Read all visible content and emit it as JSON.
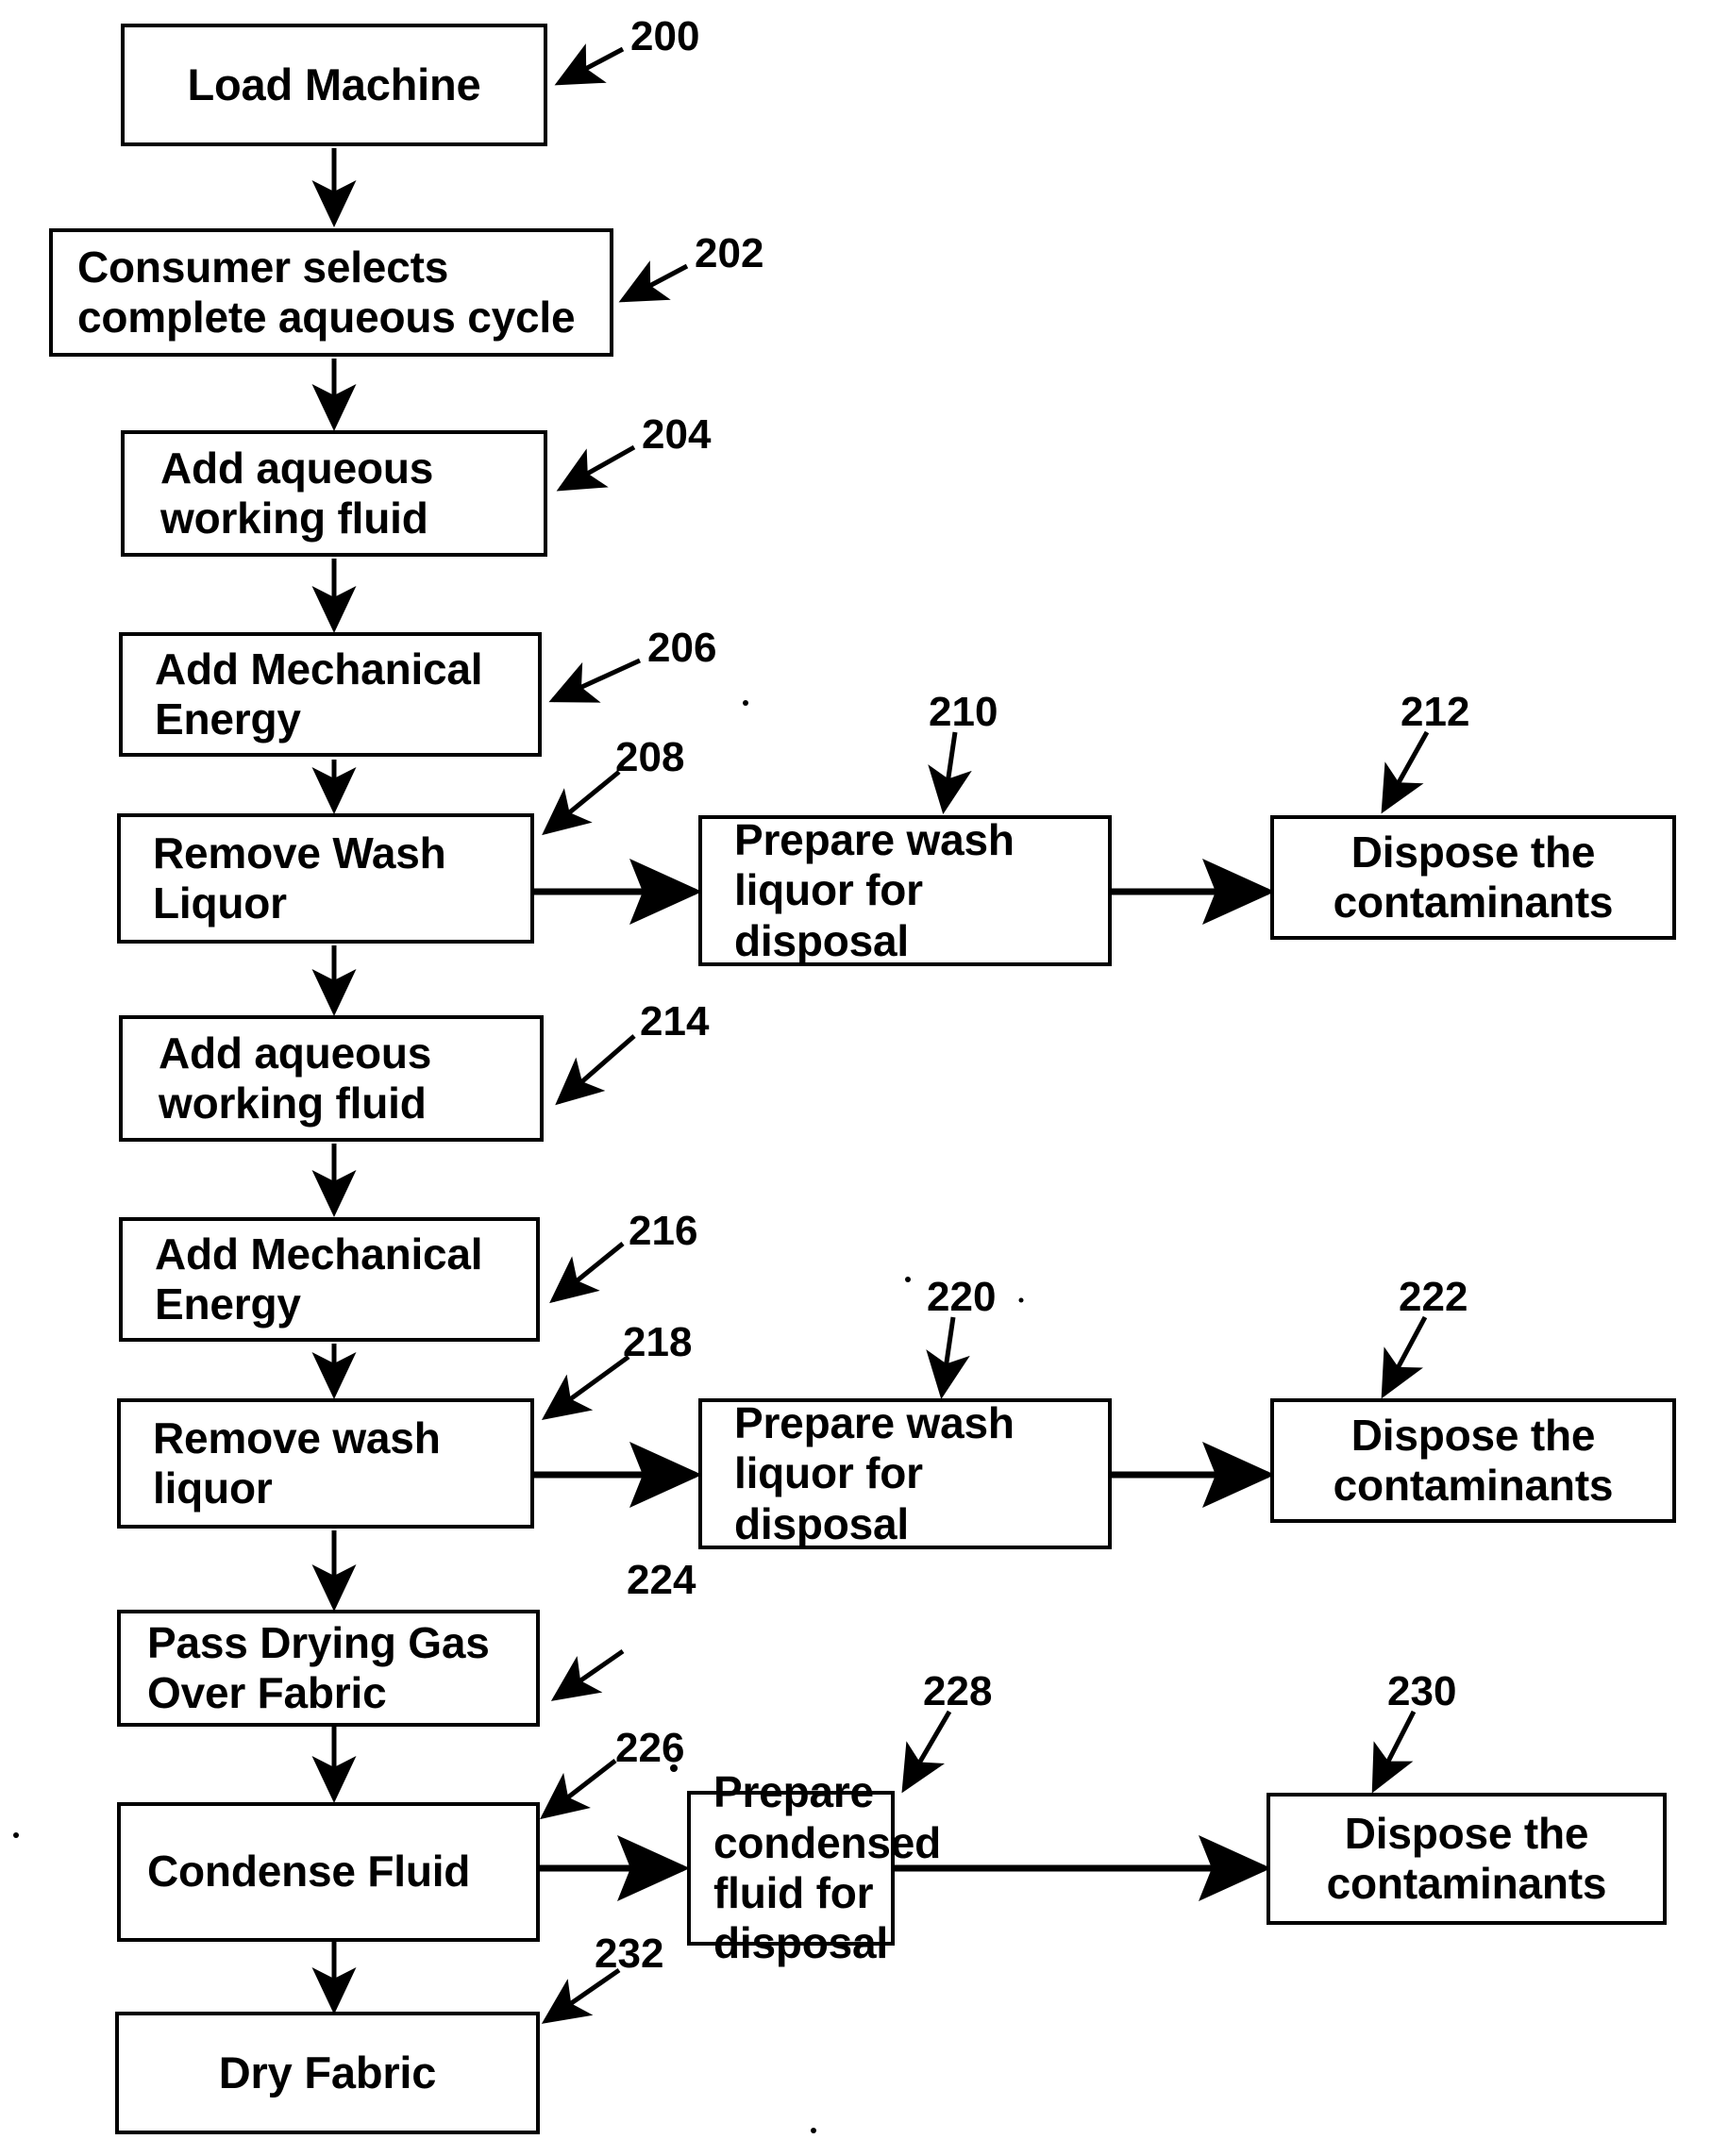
{
  "figure": {
    "type": "patent-process-flowchart",
    "background_color": "#ffffff",
    "line_color": "#000000"
  },
  "nodes": [
    {
      "id": "n200",
      "ref": "200",
      "label": "Load Machine",
      "align": "center"
    },
    {
      "id": "n202",
      "ref": "202",
      "label": "Consumer selects\ncomplete aqueous cycle",
      "align": "left"
    },
    {
      "id": "n204",
      "ref": "204",
      "label": "Add aqueous\nworking fluid",
      "align": "left"
    },
    {
      "id": "n206",
      "ref": "206",
      "label": "Add Mechanical\nEnergy",
      "align": "left"
    },
    {
      "id": "n208",
      "ref": "208",
      "label": "Remove Wash\nLiquor",
      "align": "left"
    },
    {
      "id": "n210",
      "ref": "210",
      "label": "Prepare wash\nliquor for\ndisposal",
      "align": "left"
    },
    {
      "id": "n212",
      "ref": "212",
      "label": "Dispose the\ncontaminants",
      "align": "center"
    },
    {
      "id": "n214",
      "ref": "214",
      "label": "Add aqueous\nworking fluid",
      "align": "left"
    },
    {
      "id": "n216",
      "ref": "216",
      "label": "Add Mechanical\nEnergy",
      "align": "left"
    },
    {
      "id": "n218",
      "ref": "218",
      "label": "Remove wash\nliquor",
      "align": "left"
    },
    {
      "id": "n220",
      "ref": "220",
      "label": "Prepare wash\nliquor for\ndisposal",
      "align": "left"
    },
    {
      "id": "n222",
      "ref": "222",
      "label": "Dispose the\ncontaminants",
      "align": "center"
    },
    {
      "id": "n224",
      "ref": "224",
      "label": "Pass Drying Gas\nOver Fabric",
      "align": "left"
    },
    {
      "id": "n226",
      "ref": "226",
      "label": "Condense Fluid",
      "align": "left"
    },
    {
      "id": "n228",
      "ref": "228",
      "label": "Prepare\ncondensed\nfluid for disposal",
      "align": "left"
    },
    {
      "id": "n230",
      "ref": "230",
      "label": "Dispose the\ncontaminants",
      "align": "center"
    },
    {
      "id": "n232",
      "ref": "232",
      "label": "Dry Fabric",
      "align": "center"
    }
  ],
  "reference_numerals": [
    "200",
    "202",
    "204",
    "206",
    "208",
    "210",
    "212",
    "214",
    "216",
    "218",
    "220",
    "222",
    "224",
    "226",
    "228",
    "230",
    "232"
  ],
  "flow_sequence": [
    "Load Machine",
    "Consumer selects complete aqueous cycle",
    "Add aqueous working fluid",
    "Add Mechanical Energy",
    "Remove Wash Liquor",
    "Add aqueous working fluid",
    "Add Mechanical Energy",
    "Remove wash liquor",
    "Pass Drying Gas Over Fabric",
    "Condense Fluid",
    "Dry Fabric"
  ],
  "branches": [
    {
      "from": "Remove Wash Liquor",
      "to": "Prepare wash liquor for disposal",
      "then": "Dispose the contaminants"
    },
    {
      "from": "Remove wash liquor",
      "to": "Prepare wash liquor for disposal",
      "then": "Dispose the contaminants"
    },
    {
      "from": "Condense Fluid",
      "to": "Prepare condensed fluid for disposal",
      "then": "Dispose the contaminants"
    }
  ]
}
